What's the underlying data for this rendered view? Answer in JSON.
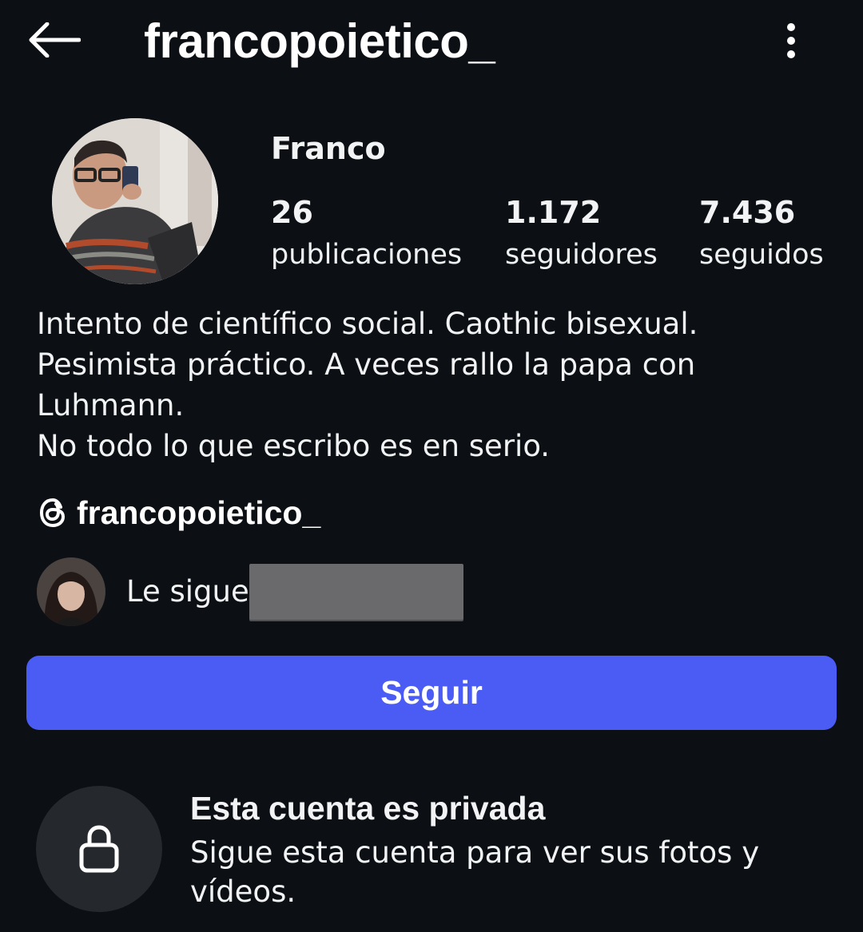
{
  "header": {
    "username": "francopoietico_",
    "back_icon": "arrow-left-icon",
    "more_icon": "more-vertical-icon"
  },
  "profile": {
    "display_name": "Franco",
    "stats": [
      {
        "count": "26",
        "label": "publicaciones"
      },
      {
        "count": "1.172",
        "label": "seguidores"
      },
      {
        "count": "7.436",
        "label": "seguidos"
      }
    ],
    "bio_lines": [
      "Intento de científico social. Caothic bisexual.",
      "Pesimista práctico. A veces rallo la papa con",
      "Luhmann.",
      "No todo lo que escribo es en serio."
    ],
    "threads_handle": "francopoietico_",
    "followed_by_prefix": "Le sigue"
  },
  "actions": {
    "follow_label": "Seguir"
  },
  "private": {
    "title": "Esta cuenta es privada",
    "description": "Sigue esta cuenta para ver sus fotos y vídeos."
  },
  "colors": {
    "background": "#0c0f14",
    "accent": "#4b5cf5",
    "lock_circle": "#25282d"
  }
}
